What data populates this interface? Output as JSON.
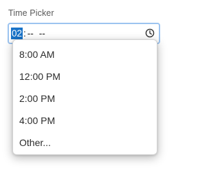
{
  "field": {
    "label": "Time Picker",
    "hour": "02",
    "separator": ":",
    "minutes": "--",
    "ampm": "--"
  },
  "icons": {
    "clock": "clock-icon"
  },
  "colors": {
    "focus_border": "#9cc4f0",
    "selection": "#1a73c8"
  },
  "dropdown": {
    "options": [
      "8:00 AM",
      "12:00 PM",
      "2:00 PM",
      "4:00 PM",
      "Other..."
    ]
  }
}
